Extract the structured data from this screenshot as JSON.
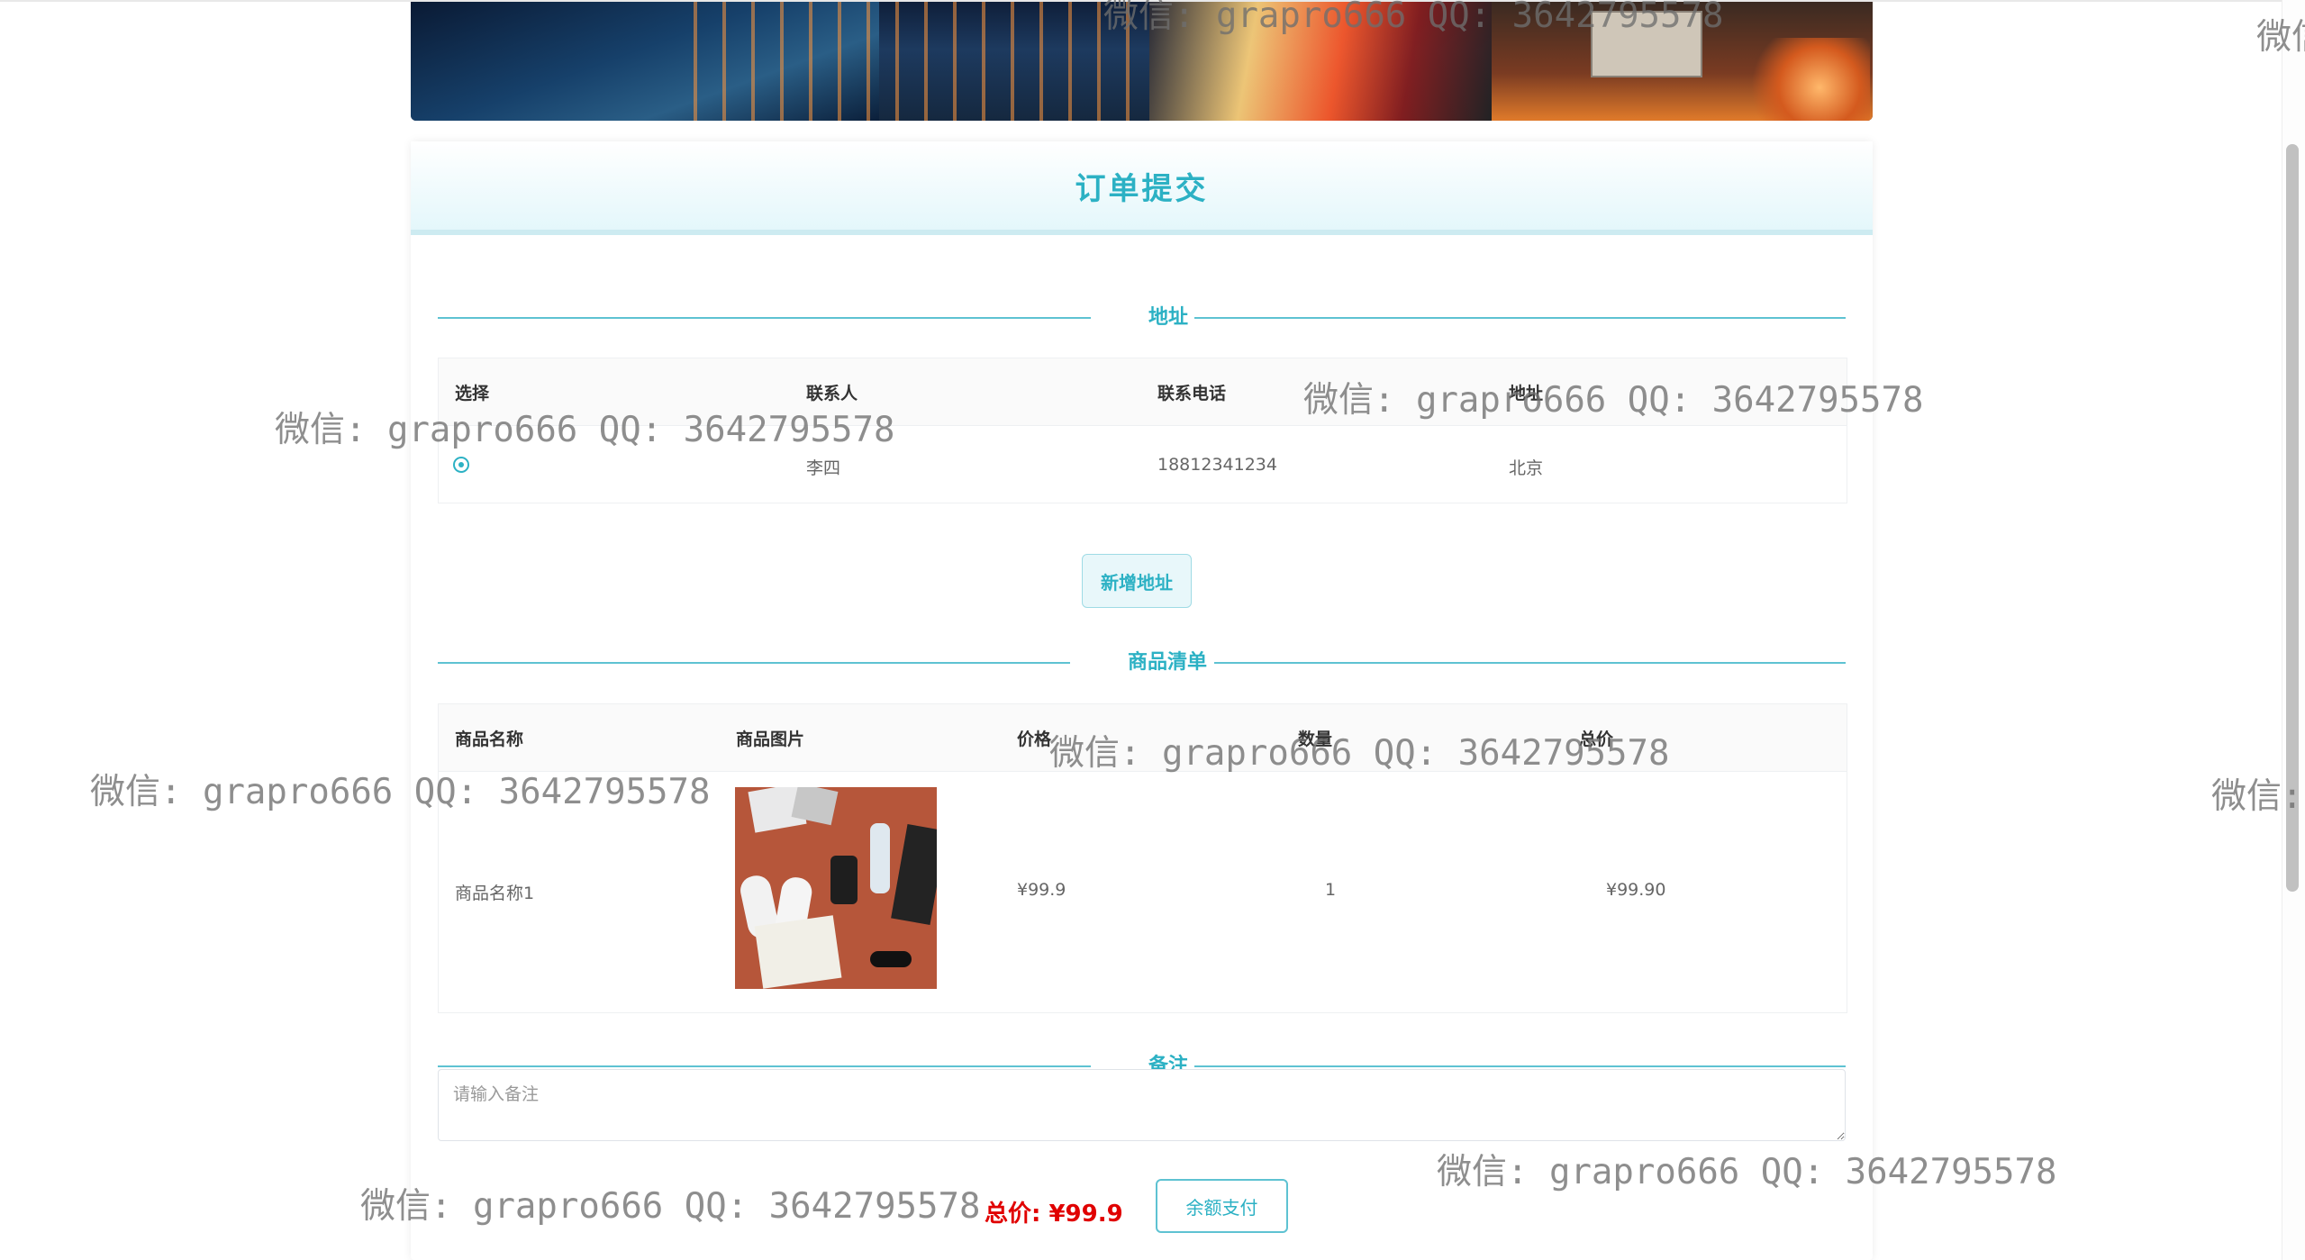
{
  "page": {
    "title": "订单提交",
    "accent_color": "#2cb1c4",
    "price_color": "#e00000"
  },
  "sections": {
    "address": "地址",
    "products": "商品清单",
    "remark": "备注"
  },
  "address_table": {
    "headers": [
      "选择",
      "联系人",
      "联系电话",
      "地址"
    ],
    "rows": [
      {
        "selected": true,
        "contact": "李四",
        "phone": "18812341234",
        "address": "北京"
      }
    ]
  },
  "buttons": {
    "add_address": "新增地址",
    "pay": "余额支付"
  },
  "product_table": {
    "headers": [
      "商品名称",
      "商品图片",
      "价格",
      "数量",
      "总价"
    ],
    "rows": [
      {
        "name": "商品名称1",
        "image_icon": "product-photo",
        "price": "¥99.9",
        "quantity": "1",
        "total": "¥99.90"
      }
    ]
  },
  "remark": {
    "placeholder": "请输入备注",
    "value": ""
  },
  "total": {
    "text": "总价: ¥99.9"
  },
  "watermark": {
    "text": "微信: grapro666 QQ: 3642795578",
    "partial_edge": "微信",
    "partial_edge2": "微信:"
  }
}
